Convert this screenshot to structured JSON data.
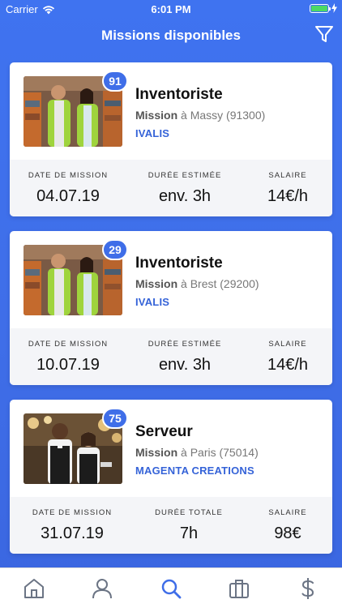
{
  "status": {
    "carrier": "Carrier",
    "time": "6:01 PM",
    "battery_level": 1.0
  },
  "nav": {
    "title": "Missions disponibles",
    "filter_icon": "filter-icon"
  },
  "missions": [
    {
      "badge": "91",
      "title": "Inventoriste",
      "loc_prefix": "Mission",
      "loc_rest": " à Massy (91300)",
      "company": "IVALIS",
      "col1_label": "DATE DE MISSION",
      "col1_value": "04.07.19",
      "col2_label": "DURÉE ESTIMÉE",
      "col2_value": "env. 3h",
      "col3_label": "SALAIRE",
      "col3_value": "14€/h",
      "image": "warehouse-workers"
    },
    {
      "badge": "29",
      "title": "Inventoriste",
      "loc_prefix": "Mission",
      "loc_rest": " à Brest (29200)",
      "company": "IVALIS",
      "col1_label": "DATE DE MISSION",
      "col1_value": "10.07.19",
      "col2_label": "DURÉE ESTIMÉE",
      "col2_value": "env. 3h",
      "col3_label": "SALAIRE",
      "col3_value": "14€/h",
      "image": "warehouse-workers"
    },
    {
      "badge": "75",
      "title": "Serveur",
      "loc_prefix": "Mission",
      "loc_rest": " à Paris (75014)",
      "company": "MAGENTA CREATIONS",
      "col1_label": "DATE DE MISSION",
      "col1_value": "31.07.19",
      "col2_label": "DURÉE TOTALE",
      "col2_value": "7h",
      "col3_label": "SALAIRE",
      "col3_value": "98€",
      "image": "waiters"
    }
  ],
  "tabs": [
    {
      "icon": "home-icon"
    },
    {
      "icon": "profile-icon"
    },
    {
      "icon": "search-icon",
      "active": true
    },
    {
      "icon": "briefcase-icon"
    },
    {
      "icon": "dollar-icon"
    }
  ],
  "colors": {
    "accent": "#3f6ee8",
    "company": "#3563d8",
    "tab_active": "#3f6ee8",
    "tab_inactive": "#6b7484"
  }
}
